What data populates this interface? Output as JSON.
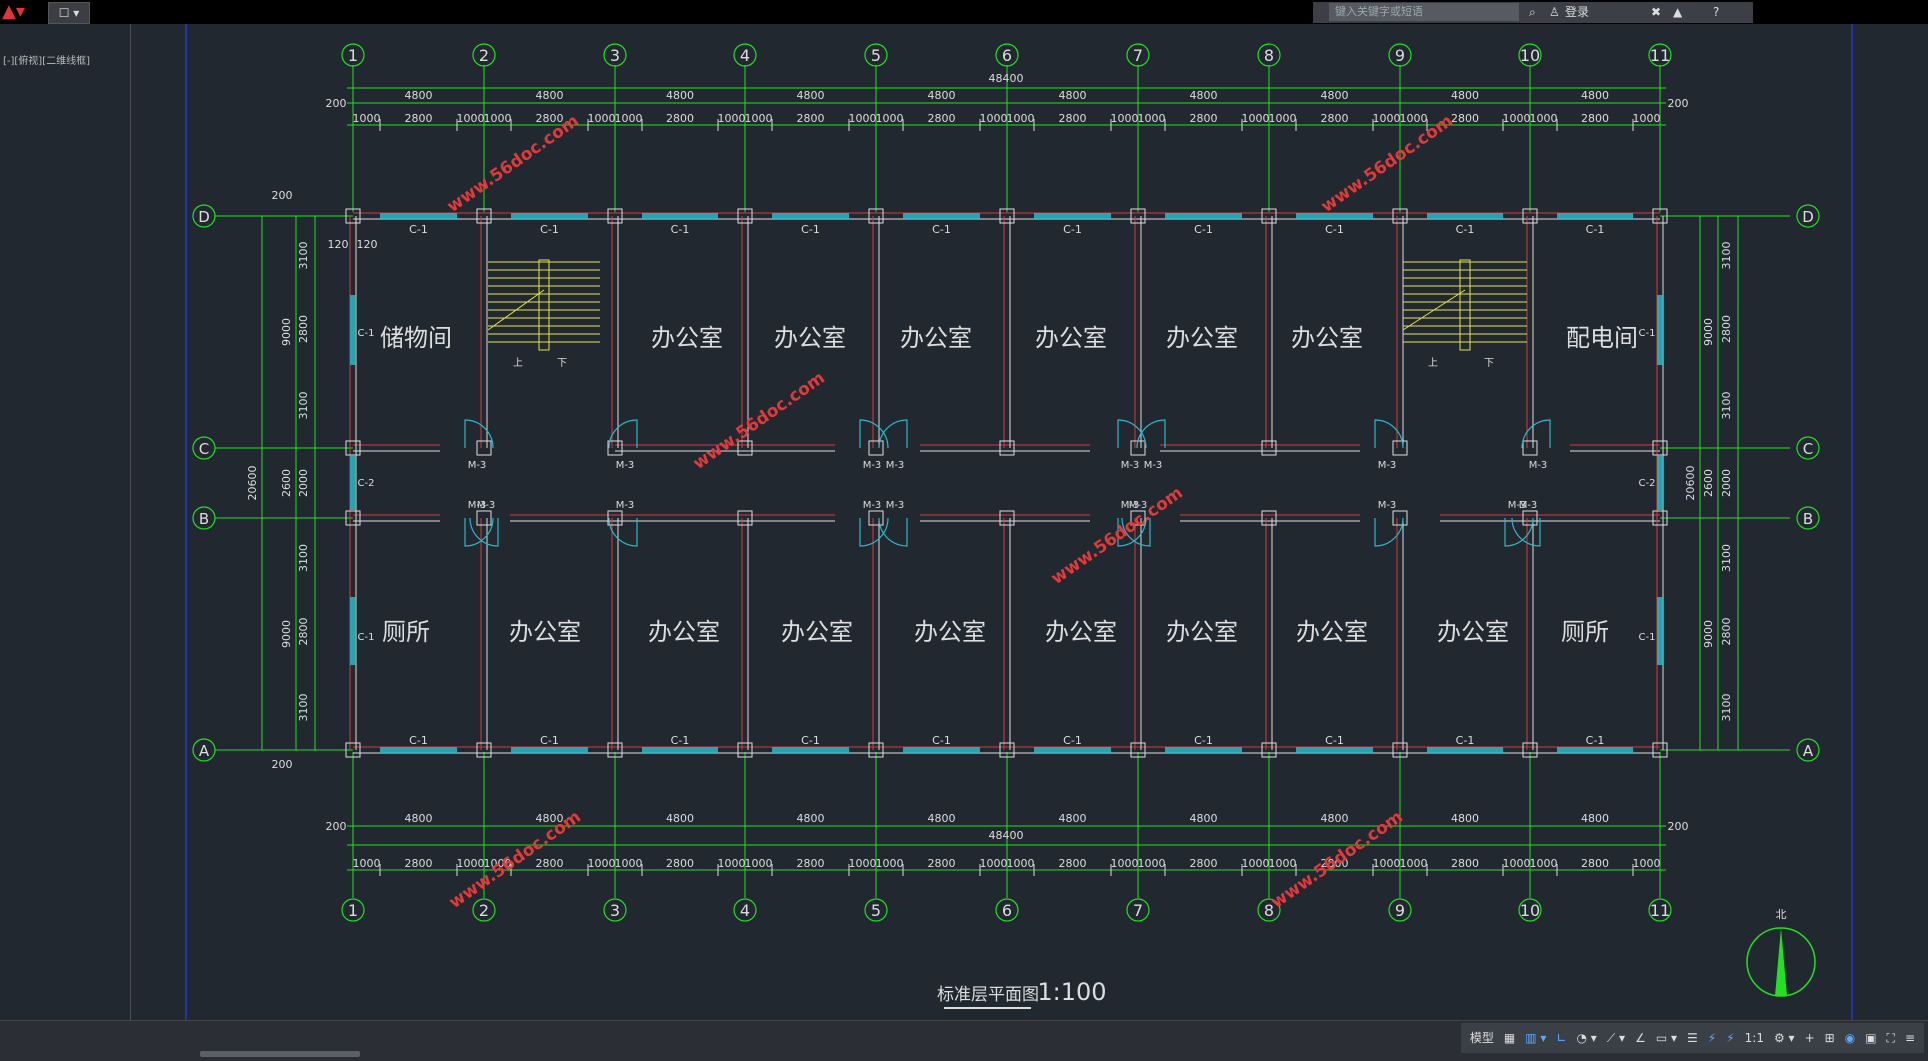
{
  "app": {
    "search_placeholder": "键入关键字或短语",
    "login": "登录",
    "view_label": "[-][俯视][二维线框]",
    "win_buttons": [
      "–",
      "❐",
      "✕"
    ]
  },
  "status": {
    "model": "模型",
    "grid": "#",
    "scale": "1:1",
    "icons": [
      "grid-icon",
      "snap-icon",
      "ortho-icon",
      "polar-icon",
      "osnap-icon",
      "otrack-icon",
      "annotation-icon",
      "gear-icon",
      "plus-icon",
      "workspace-icon",
      "menu-icon"
    ]
  },
  "drawing": {
    "title": "标准层平面图",
    "scale": "1:100",
    "north": "北",
    "col_axes": [
      "1",
      "2",
      "3",
      "4",
      "5",
      "6",
      "7",
      "8",
      "9",
      "10",
      "11"
    ],
    "row_axes": [
      "D",
      "C",
      "B",
      "A"
    ],
    "bay_dim": "4800",
    "total_dim": "48400",
    "edge_dim": "200",
    "sub_dims": [
      "1000",
      "2800",
      "1000"
    ],
    "left_dims": [
      "3100",
      "2800",
      "3100",
      "2000",
      "3100",
      "2800",
      "3100"
    ],
    "left_group_dims": [
      "9000",
      "2600",
      "9000"
    ],
    "overall_side": "20600",
    "wall_dims": [
      "120",
      "120"
    ],
    "rooms_top": [
      "储物间",
      "办公室",
      "办公室",
      "办公室",
      "办公室",
      "办公室",
      "办公室",
      "配电间"
    ],
    "rooms_bottom": [
      "厕所",
      "办公室",
      "办公室",
      "办公室",
      "办公室",
      "办公室",
      "办公室",
      "办公室",
      "办公室",
      "厕所"
    ],
    "window": "C-1",
    "window2": "C-2",
    "door": "M-3",
    "stair_up": "上",
    "stair_down": "下",
    "watermark": "www.56doc.com"
  }
}
